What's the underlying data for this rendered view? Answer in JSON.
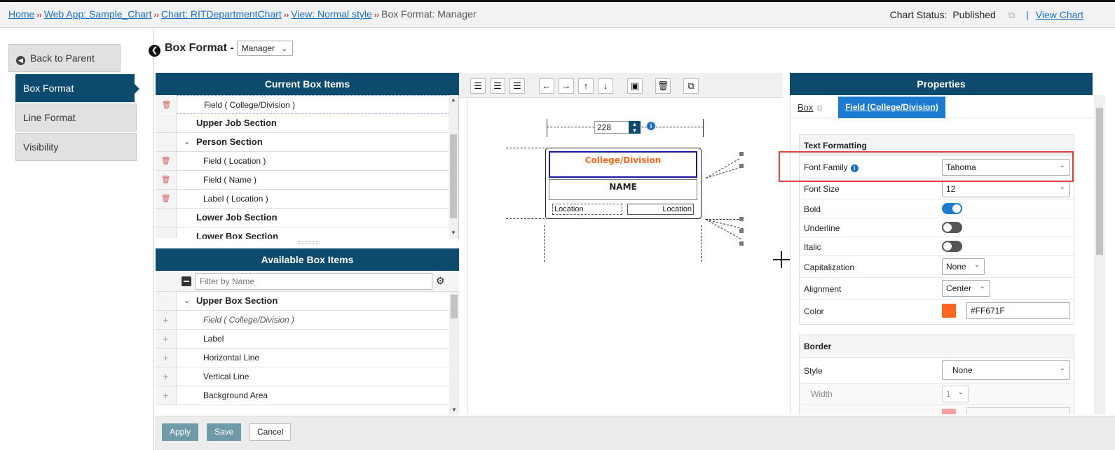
{
  "breadcrumb": {
    "home": "Home",
    "web_app": "Web App: Sample_Chart",
    "chart": "Chart: RITDepartmentChart",
    "view": "View: Normal style",
    "sep": "››",
    "current": "Box Format: Manager"
  },
  "status": {
    "label": "Chart Status:",
    "value": "Published",
    "divider": "|",
    "view_chart": "View Chart"
  },
  "nav": {
    "back": "Back to Parent",
    "items": [
      "Box Format",
      "Line Format",
      "Visibility"
    ]
  },
  "box_format": {
    "title": "Box Format -",
    "selected": "Manager"
  },
  "current_items": {
    "title": "Current Box Items",
    "rows": [
      {
        "label": "Field  ( College/Division )",
        "type": "field"
      },
      {
        "label": "Upper Job Section",
        "type": "section"
      },
      {
        "label": "Person Section",
        "type": "section-open"
      },
      {
        "label": "Field  ( Location )",
        "type": "field"
      },
      {
        "label": "Field  ( Name )",
        "type": "field"
      },
      {
        "label": "Label  ( Location )",
        "type": "field"
      },
      {
        "label": "Lower Job Section",
        "type": "section"
      },
      {
        "label": "Lower Box Section",
        "type": "section"
      }
    ]
  },
  "available_items": {
    "title": "Available Box Items",
    "filter_placeholder": "Filter by Name",
    "rows": [
      {
        "label": "Upper Box Section",
        "type": "section-open"
      },
      {
        "label": "Field  ( College/Division )",
        "type": "italic"
      },
      {
        "label": "Label",
        "type": "field"
      },
      {
        "label": "Horizontal Line",
        "type": "field"
      },
      {
        "label": "Vertical Line",
        "type": "field"
      },
      {
        "label": "Background Area",
        "type": "field"
      }
    ]
  },
  "canvas": {
    "width_value": "228",
    "college_text": "College/Division",
    "name_text": "NAME",
    "location_left": "Location",
    "location_right": "Location"
  },
  "properties": {
    "title": "Properties",
    "tab_box": "Box",
    "tab_field": "Field (College/Division)",
    "text_formatting": {
      "title": "Text Formatting",
      "font_family_label": "Font Family",
      "font_family": "Tahoma",
      "font_size_label": "Font Size",
      "font_size": "12",
      "bold_label": "Bold",
      "bold": true,
      "underline_label": "Underline",
      "underline": false,
      "italic_label": "Italic",
      "italic": false,
      "capitalization_label": "Capitalization",
      "capitalization": "None",
      "alignment_label": "Alignment",
      "alignment": "Center",
      "color_label": "Color",
      "color": "#FF671F"
    },
    "border": {
      "title": "Border",
      "style_label": "Style",
      "style": "None",
      "width_label": "Width",
      "width": "1"
    }
  },
  "footer": {
    "apply": "Apply",
    "save": "Save",
    "cancel": "Cancel"
  },
  "colors": {
    "header_bg": "#0C4A6E",
    "tab_active": "#1A7BD0",
    "text_color_swatch": "#FF671F",
    "highlight": "#E04040"
  }
}
